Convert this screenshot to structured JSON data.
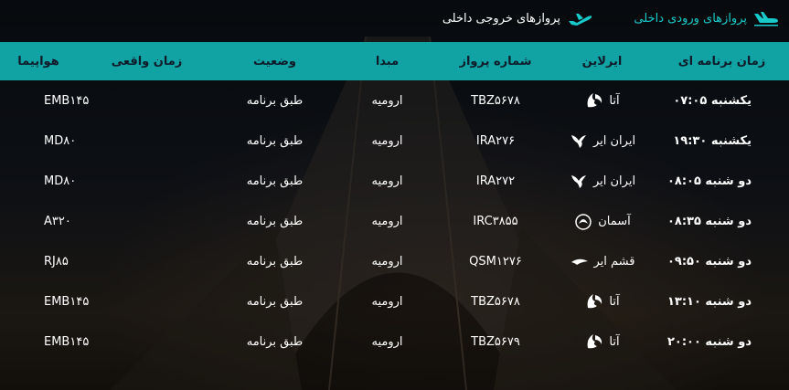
{
  "tabs": {
    "arrivals_label": "پروازهای ورودی داخلی",
    "departures_label": "پروازهای خروجی داخلی"
  },
  "columns": {
    "scheduled_time": "زمان برنامه ای",
    "airline": "ایرلاین",
    "flight_number": "شماره پرواز",
    "origin": "مبدا",
    "status": "وضعیت",
    "actual_time": "زمان واقعی",
    "aircraft": "هواپیما"
  },
  "rows": [
    {
      "time": "یکشنبه ۰۷:۰۵",
      "airline": "آتا",
      "logo": "ata-logo-icon",
      "flight": "TBZ۵۶۷۸",
      "origin": "ارومیه",
      "status": "طبق برنامه",
      "actual": "",
      "aircraft": "EMB۱۴۵"
    },
    {
      "time": "یکشنبه ۱۹:۳۰",
      "airline": "ایران ایر",
      "logo": "iranair-logo-icon",
      "flight": "IRA۲۷۶",
      "origin": "ارومیه",
      "status": "طبق برنامه",
      "actual": "",
      "aircraft": "MD۸۰"
    },
    {
      "time": "دو شنبه ۰۸:۰۵",
      "airline": "ایران ایر",
      "logo": "iranair-logo-icon",
      "flight": "IRA۲۷۲",
      "origin": "ارومیه",
      "status": "طبق برنامه",
      "actual": "",
      "aircraft": "MD۸۰"
    },
    {
      "time": "دو شنبه ۰۸:۳۵",
      "airline": "آسمان",
      "logo": "aseman-logo-icon",
      "flight": "IRC۳۸۵۵",
      "origin": "ارومیه",
      "status": "طبق برنامه",
      "actual": "",
      "aircraft": "A۳۲۰"
    },
    {
      "time": "دو شنبه ۰۹:۵۰",
      "airline": "قشم ایر",
      "logo": "qeshmair-logo-icon",
      "flight": "QSM۱۲۷۶",
      "origin": "ارومیه",
      "status": "طبق برنامه",
      "actual": "",
      "aircraft": "RJ۸۵"
    },
    {
      "time": "دو شنبه ۱۳:۱۰",
      "airline": "آتا",
      "logo": "ata-logo-icon",
      "flight": "TBZ۵۶۷۸",
      "origin": "ارومیه",
      "status": "طبق برنامه",
      "actual": "",
      "aircraft": "EMB۱۴۵"
    },
    {
      "time": "دو شنبه ۲۰:۰۰",
      "airline": "آتا",
      "logo": "ata-logo-icon",
      "flight": "TBZ۵۶۷۹",
      "origin": "ارومیه",
      "status": "طبق برنامه",
      "actual": "",
      "aircraft": "EMB۱۴۵"
    }
  ],
  "colors": {
    "accent": "#11a3a3",
    "active_tab": "#18c9c9"
  }
}
